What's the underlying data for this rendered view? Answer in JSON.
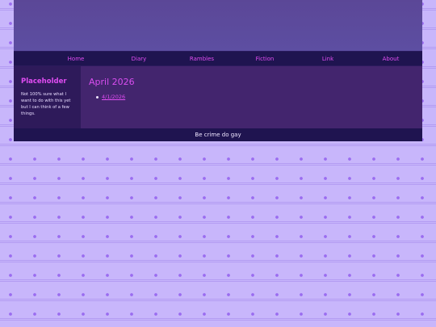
{
  "nav": {
    "items": [
      {
        "label": "Home"
      },
      {
        "label": "Diary"
      },
      {
        "label": "Rambles"
      },
      {
        "label": "Fiction"
      },
      {
        "label": "Link"
      },
      {
        "label": "About"
      }
    ]
  },
  "sidebar": {
    "title": "Placeholder",
    "text": "Not 100% sure what I want to do with this yet but I can think of a few things."
  },
  "main": {
    "heading": "April 2026",
    "entries": [
      {
        "label": "4/1/2026"
      }
    ]
  },
  "footer": {
    "text": "Be crime do gay"
  },
  "colors": {
    "accent": "#e04cf2",
    "background": "#c8b6fb",
    "nav_background": "#1f1450"
  }
}
